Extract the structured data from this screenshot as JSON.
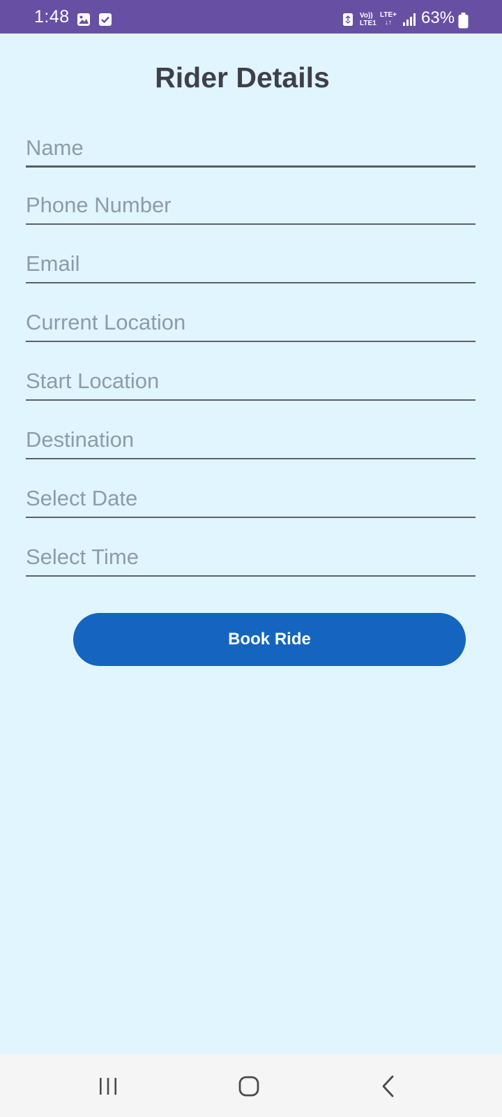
{
  "status_bar": {
    "time": "1:48",
    "network_top": "Vo))",
    "network_bottom": "LTE1",
    "lte_label": "LTE+",
    "lte_arrows": "↓↑",
    "battery": "63%",
    "icons": [
      "gallery-icon",
      "check-icon",
      "recycle-icon",
      "signal-icon",
      "battery-icon"
    ],
    "background_color": "#6750A4"
  },
  "page": {
    "title": "Rider Details",
    "background_color": "#E1F5FE"
  },
  "form": {
    "fields": [
      {
        "name": "name-field",
        "placeholder": "Name",
        "value": ""
      },
      {
        "name": "phone-number-field",
        "placeholder": "Phone Number",
        "value": ""
      },
      {
        "name": "email-field",
        "placeholder": "Email",
        "value": ""
      },
      {
        "name": "current-location-field",
        "placeholder": "Current Location",
        "value": ""
      },
      {
        "name": "start-location-field",
        "placeholder": "Start Location",
        "value": ""
      },
      {
        "name": "destination-field",
        "placeholder": "Destination",
        "value": ""
      },
      {
        "name": "select-date-field",
        "placeholder": "Select Date",
        "value": ""
      },
      {
        "name": "select-time-field",
        "placeholder": "Select Time",
        "value": ""
      }
    ],
    "submit_label": "Book Ride",
    "submit_color": "#1565C0"
  },
  "nav_bar": {
    "buttons": [
      "recents-icon",
      "home-icon",
      "back-icon"
    ]
  }
}
